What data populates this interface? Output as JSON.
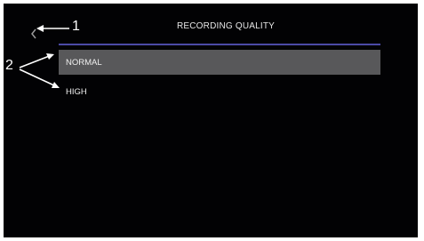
{
  "header": {
    "title": "RECORDING QUALITY",
    "back_icon": "chevron-left-icon"
  },
  "options": [
    {
      "label": "NORMAL",
      "selected": true
    },
    {
      "label": "HIGH",
      "selected": false
    }
  ],
  "callouts": {
    "one": "1",
    "two": "2"
  },
  "colors": {
    "background": "#020204",
    "accent_line": "#4b4aa6",
    "selected_row": "#58585a",
    "text": "#e6e6e6"
  }
}
